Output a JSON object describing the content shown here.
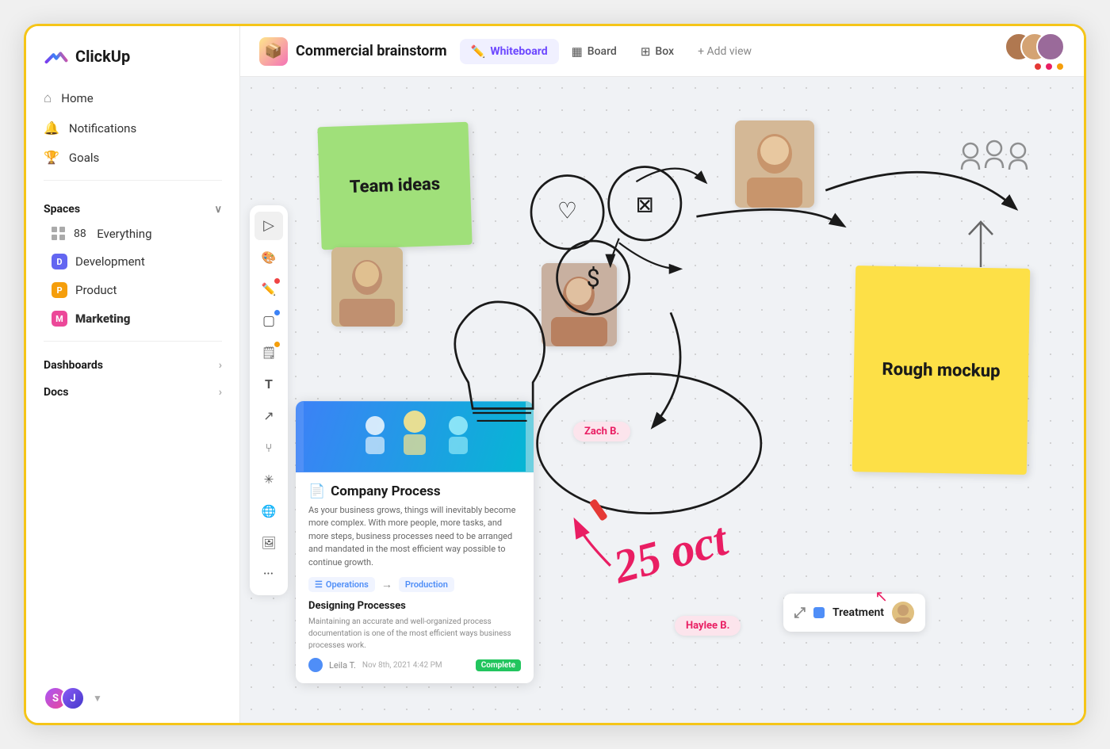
{
  "app": {
    "name": "ClickUp"
  },
  "sidebar": {
    "nav": [
      {
        "id": "home",
        "label": "Home",
        "icon": "🏠"
      },
      {
        "id": "notifications",
        "label": "Notifications",
        "icon": "🔔"
      },
      {
        "id": "goals",
        "label": "Goals",
        "icon": "🏆"
      }
    ],
    "spaces_label": "Spaces",
    "spaces": [
      {
        "id": "everything",
        "label": "Everything",
        "count": "88",
        "color": null,
        "icon": "grid"
      },
      {
        "id": "development",
        "label": "Development",
        "color": "#6366f1",
        "initial": "D"
      },
      {
        "id": "product",
        "label": "Product",
        "color": "#f59e0b",
        "initial": "P"
      },
      {
        "id": "marketing",
        "label": "Marketing",
        "color": "#ec4899",
        "initial": "M",
        "bold": true
      }
    ],
    "dashboards_label": "Dashboards",
    "docs_label": "Docs"
  },
  "header": {
    "title": "Commercial brainstorm",
    "tabs": [
      {
        "id": "whiteboard",
        "label": "Whiteboard",
        "icon": "✏️",
        "active": true
      },
      {
        "id": "board",
        "label": "Board",
        "icon": "▦"
      },
      {
        "id": "box",
        "label": "Box",
        "icon": "⊞"
      }
    ],
    "add_view": "+ Add view",
    "avatars": [
      {
        "id": "a1",
        "color": "#c97d50",
        "dot": "#e53935"
      },
      {
        "id": "a2",
        "color": "#d4a373",
        "dot": "#e91e63"
      },
      {
        "id": "a3",
        "color": "#8a6a9a",
        "dot": "#f59e0b"
      }
    ]
  },
  "toolbar": {
    "tools": [
      {
        "id": "cursor",
        "icon": "▷",
        "dot": null
      },
      {
        "id": "palette",
        "icon": "🎨",
        "dot": null
      },
      {
        "id": "pen",
        "icon": "✏️",
        "dot": "#ef4444"
      },
      {
        "id": "rect",
        "icon": "▢",
        "dot": "#3b82f6"
      },
      {
        "id": "note",
        "icon": "🗒️",
        "dot": "#f59e0b"
      },
      {
        "id": "text",
        "icon": "T",
        "dot": null
      },
      {
        "id": "shapes",
        "icon": "↗",
        "dot": null
      },
      {
        "id": "share",
        "icon": "⑂",
        "dot": null
      },
      {
        "id": "star",
        "icon": "✳",
        "dot": null
      },
      {
        "id": "globe",
        "icon": "🌐",
        "dot": null
      },
      {
        "id": "image",
        "icon": "🖼",
        "dot": null
      },
      {
        "id": "more",
        "icon": "•••",
        "dot": null
      }
    ]
  },
  "whiteboard": {
    "sticky_green": {
      "text": "Team ideas"
    },
    "sticky_yellow": {
      "text": "Rough mockup"
    },
    "doc_card": {
      "title": "Company Process",
      "desc": "As your business grows, things will inevitably become more complex. With more people, more tasks, and more steps, business processes need to be arranged and mandated in the most efficient way possible to continue growth.",
      "flow_from": "Operations",
      "flow_to": "Production",
      "section": "Designing Processes",
      "section_text": "Maintaining an accurate and well-organized process documentation is one of the most efficient ways business processes work.",
      "author": "Leila T.",
      "date": "Nov 8th, 2021 4:42 PM",
      "status": "Complete"
    },
    "user_tag_1": "Zach B.",
    "user_tag_2": "Haylee B.",
    "treatment": {
      "label": "Treatment"
    },
    "date_text": "25 oct"
  }
}
